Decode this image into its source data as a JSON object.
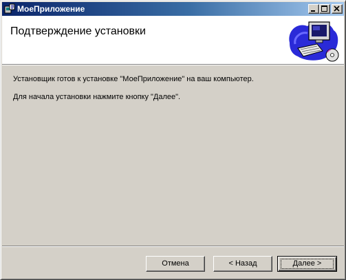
{
  "window": {
    "title": "МоеПриложение",
    "icon": "installer-icon"
  },
  "header": {
    "title": "Подтверждение установки",
    "art": "computer-illustration"
  },
  "body": {
    "line1": "Установщик готов к установке \"МоеПриложение\" на ваш компьютер.",
    "line2": "Для начала установки нажмите кнопку \"Далее\"."
  },
  "buttons": {
    "cancel": "Отмена",
    "back": "< Назад",
    "next": "Далее >"
  },
  "colors": {
    "titlebar_start": "#0a246a",
    "titlebar_end": "#a6caf0",
    "face": "#d4d0c8"
  }
}
